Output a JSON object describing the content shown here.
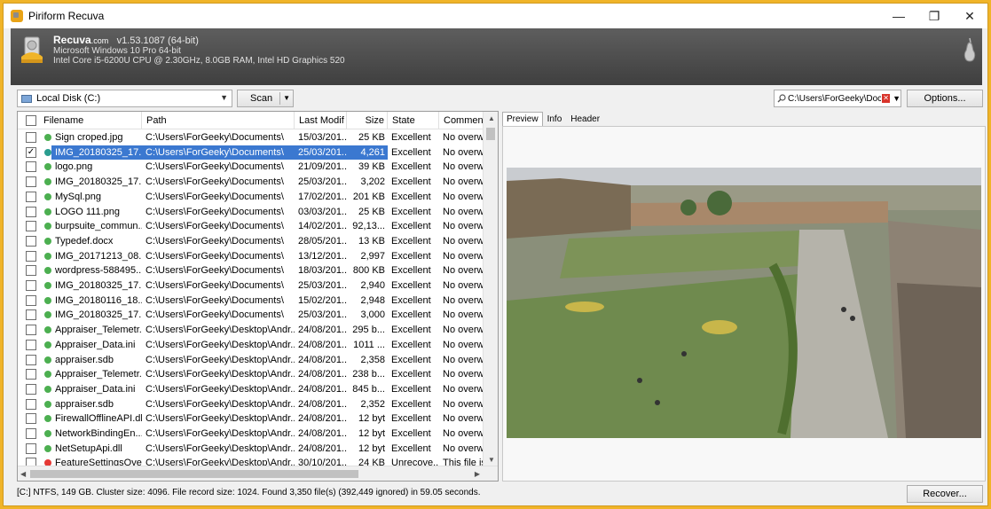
{
  "window": {
    "title": "Piriform Recuva",
    "minimize": "—",
    "maximize": "❐",
    "close": "✕"
  },
  "header": {
    "brand": "Recuva",
    "brand_suffix": ".com",
    "version": "v1.53.1087 (64-bit)",
    "os": "Microsoft Windows 10 Pro 64-bit",
    "hardware": "Intel Core i5-6200U CPU @ 2.30GHz, 8.0GB RAM, Intel HD Graphics 520"
  },
  "toolbar": {
    "drive": "Local Disk (C:)",
    "scan_label": "Scan",
    "path_value": "C:\\Users\\ForGeeky\\Docun",
    "options_label": "Options..."
  },
  "columns": [
    "Filename",
    "Path",
    "Last Modif",
    "Size",
    "State",
    "Comment"
  ],
  "files": [
    {
      "name": "Sign croped.jpg",
      "path": "C:\\Users\\ForGeeky\\Documents\\",
      "date": "15/03/201...",
      "size": "25 KB",
      "state": "Excellent",
      "comment": "No overwr",
      "status": "green",
      "checked": false,
      "selected": false
    },
    {
      "name": "IMG_20180325_17...",
      "path": "C:\\Users\\ForGeeky\\Documents\\",
      "date": "25/03/201...",
      "size": "4,261",
      "state": "Excellent",
      "comment": "No overwr",
      "status": "teal",
      "checked": true,
      "selected": true
    },
    {
      "name": "logo.png",
      "path": "C:\\Users\\ForGeeky\\Documents\\",
      "date": "21/09/201...",
      "size": "39 KB",
      "state": "Excellent",
      "comment": "No overwr",
      "status": "green",
      "checked": false,
      "selected": false
    },
    {
      "name": "IMG_20180325_17...",
      "path": "C:\\Users\\ForGeeky\\Documents\\",
      "date": "25/03/201...",
      "size": "3,202",
      "state": "Excellent",
      "comment": "No overwr",
      "status": "green",
      "checked": false,
      "selected": false
    },
    {
      "name": "MySql.png",
      "path": "C:\\Users\\ForGeeky\\Documents\\",
      "date": "17/02/201...",
      "size": "201 KB",
      "state": "Excellent",
      "comment": "No overwr",
      "status": "green",
      "checked": false,
      "selected": false
    },
    {
      "name": "LOGO 111.png",
      "path": "C:\\Users\\ForGeeky\\Documents\\",
      "date": "03/03/201...",
      "size": "25 KB",
      "state": "Excellent",
      "comment": "No overwr",
      "status": "green",
      "checked": false,
      "selected": false
    },
    {
      "name": "burpsuite_commun...",
      "path": "C:\\Users\\ForGeeky\\Documents\\",
      "date": "14/02/201...",
      "size": "92,13...",
      "state": "Excellent",
      "comment": "No overwr",
      "status": "green",
      "checked": false,
      "selected": false
    },
    {
      "name": "Typedef.docx",
      "path": "C:\\Users\\ForGeeky\\Documents\\",
      "date": "28/05/201...",
      "size": "13 KB",
      "state": "Excellent",
      "comment": "No overwr",
      "status": "green",
      "checked": false,
      "selected": false
    },
    {
      "name": "IMG_20171213_08...",
      "path": "C:\\Users\\ForGeeky\\Documents\\",
      "date": "13/12/201...",
      "size": "2,997",
      "state": "Excellent",
      "comment": "No overwr",
      "status": "green",
      "checked": false,
      "selected": false
    },
    {
      "name": "wordpress-588495...",
      "path": "C:\\Users\\ForGeeky\\Documents\\",
      "date": "18/03/201...",
      "size": "800 KB",
      "state": "Excellent",
      "comment": "No overwr",
      "status": "green",
      "checked": false,
      "selected": false
    },
    {
      "name": "IMG_20180325_17...",
      "path": "C:\\Users\\ForGeeky\\Documents\\",
      "date": "25/03/201...",
      "size": "2,940",
      "state": "Excellent",
      "comment": "No overwr",
      "status": "green",
      "checked": false,
      "selected": false
    },
    {
      "name": "IMG_20180116_18...",
      "path": "C:\\Users\\ForGeeky\\Documents\\",
      "date": "15/02/201...",
      "size": "2,948",
      "state": "Excellent",
      "comment": "No overwr",
      "status": "green",
      "checked": false,
      "selected": false
    },
    {
      "name": "IMG_20180325_17...",
      "path": "C:\\Users\\ForGeeky\\Documents\\",
      "date": "25/03/201...",
      "size": "3,000",
      "state": "Excellent",
      "comment": "No overwr",
      "status": "green",
      "checked": false,
      "selected": false
    },
    {
      "name": "Appraiser_Telemetr...",
      "path": "C:\\Users\\ForGeeky\\Desktop\\Andr...",
      "date": "24/08/201...",
      "size": "295 b...",
      "state": "Excellent",
      "comment": "No overwr",
      "status": "green",
      "checked": false,
      "selected": false
    },
    {
      "name": "Appraiser_Data.ini",
      "path": "C:\\Users\\ForGeeky\\Desktop\\Andr...",
      "date": "24/08/201...",
      "size": "1011 ...",
      "state": "Excellent",
      "comment": "No overwr",
      "status": "green",
      "checked": false,
      "selected": false
    },
    {
      "name": "appraiser.sdb",
      "path": "C:\\Users\\ForGeeky\\Desktop\\Andr...",
      "date": "24/08/201...",
      "size": "2,358",
      "state": "Excellent",
      "comment": "No overwr",
      "status": "green",
      "checked": false,
      "selected": false
    },
    {
      "name": "Appraiser_Telemetr...",
      "path": "C:\\Users\\ForGeeky\\Desktop\\Andr...",
      "date": "24/08/201...",
      "size": "238 b...",
      "state": "Excellent",
      "comment": "No overwr",
      "status": "green",
      "checked": false,
      "selected": false
    },
    {
      "name": "Appraiser_Data.ini",
      "path": "C:\\Users\\ForGeeky\\Desktop\\Andr...",
      "date": "24/08/201...",
      "size": "845 b...",
      "state": "Excellent",
      "comment": "No overwr",
      "status": "green",
      "checked": false,
      "selected": false
    },
    {
      "name": "appraiser.sdb",
      "path": "C:\\Users\\ForGeeky\\Desktop\\Andr...",
      "date": "24/08/201...",
      "size": "2,352",
      "state": "Excellent",
      "comment": "No overwr",
      "status": "green",
      "checked": false,
      "selected": false
    },
    {
      "name": "FirewallOfflineAPI.dll",
      "path": "C:\\Users\\ForGeeky\\Desktop\\Andr...",
      "date": "24/08/201...",
      "size": "12 byt",
      "state": "Excellent",
      "comment": "No overwr",
      "status": "green",
      "checked": false,
      "selected": false
    },
    {
      "name": "NetworkBindingEn...",
      "path": "C:\\Users\\ForGeeky\\Desktop\\Andr...",
      "date": "24/08/201...",
      "size": "12 byt",
      "state": "Excellent",
      "comment": "No overwr",
      "status": "green",
      "checked": false,
      "selected": false
    },
    {
      "name": "NetSetupApi.dll",
      "path": "C:\\Users\\ForGeeky\\Desktop\\Andr...",
      "date": "24/08/201...",
      "size": "12 byt",
      "state": "Excellent",
      "comment": "No overwr",
      "status": "green",
      "checked": false,
      "selected": false
    },
    {
      "name": "FeatureSettingsOve...",
      "path": "C:\\Users\\ForGeeky\\Desktop\\Andr...",
      "date": "30/10/201...",
      "size": "24 KB",
      "state": "Unrecove...",
      "comment": "This file is",
      "status": "red",
      "checked": false,
      "selected": false
    }
  ],
  "status_colors": {
    "green": "#4caf50",
    "teal": "#2a9d8f",
    "red": "#e53935"
  },
  "preview_tabs": [
    {
      "label": "Preview",
      "active": true
    },
    {
      "label": "Info",
      "active": false
    },
    {
      "label": "Header",
      "active": false
    }
  ],
  "status_bar": "[C:] NTFS, 149 GB. Cluster size: 4096. File record size: 1024. Found 3,350 file(s) (392,449 ignored) in 59.05 seconds.",
  "recover_label": "Recover...",
  "icons": [
    "app-icon",
    "hard-drive-recuva-icon",
    "pear-icon",
    "drive-icon",
    "chevron-down-icon",
    "search-icon",
    "clear-icon",
    "checkbox-icon",
    "status-dot-icon"
  ]
}
